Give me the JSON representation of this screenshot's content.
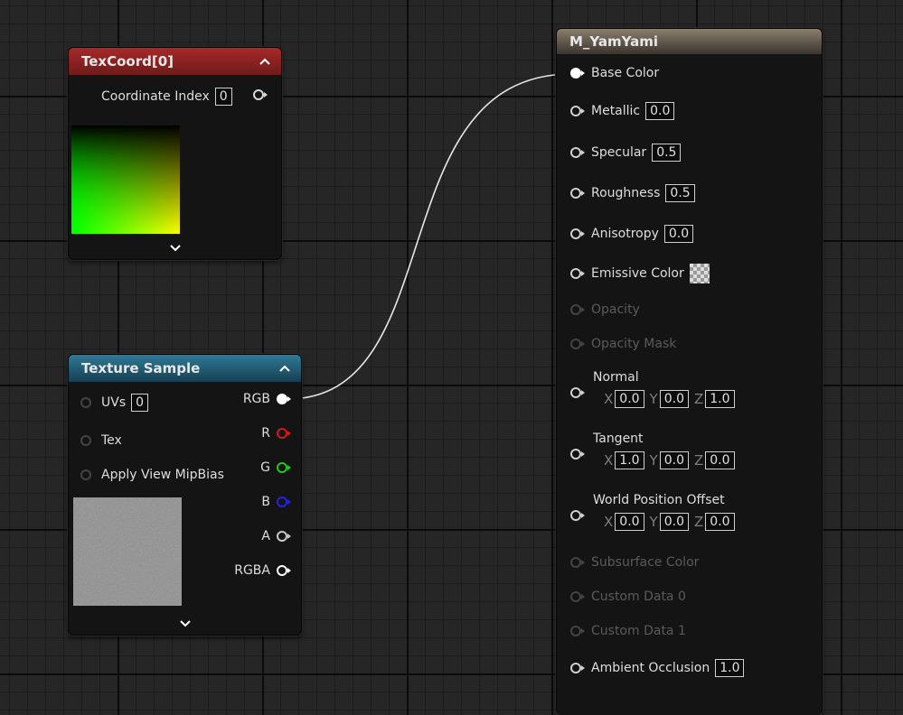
{
  "texcoord": {
    "title": "TexCoord[0]",
    "coordinate_index_label": "Coordinate Index",
    "coordinate_index_value": "0",
    "header_color": "#8a1f1f"
  },
  "texture_sample": {
    "title": "Texture Sample",
    "header_color": "#1f5a73",
    "inputs": [
      {
        "label": "UVs",
        "value": "0"
      },
      {
        "label": "Tex"
      },
      {
        "label": "Apply View MipBias"
      }
    ],
    "outputs": [
      {
        "label": "RGB",
        "color": "#ffffff"
      },
      {
        "label": "R",
        "color": "#d21a1a"
      },
      {
        "label": "G",
        "color": "#1ec81e"
      },
      {
        "label": "B",
        "color": "#2323e0"
      },
      {
        "label": "A",
        "color": "#c8c8c8"
      },
      {
        "label": "RGBA",
        "color": "#ffffff"
      }
    ]
  },
  "material": {
    "title": "M_YamYami",
    "header_color": "#5a5146",
    "base_color": "Base Color",
    "metallic": {
      "label": "Metallic",
      "value": "0.0"
    },
    "specular": {
      "label": "Specular",
      "value": "0.5"
    },
    "roughness": {
      "label": "Roughness",
      "value": "0.5"
    },
    "anisotropy": {
      "label": "Anisotropy",
      "value": "0.0"
    },
    "emissive": "Emissive Color",
    "opacity": "Opacity",
    "opacity_mask": "Opacity Mask",
    "normal": {
      "label": "Normal",
      "x": "0.0",
      "y": "0.0",
      "z": "1.0"
    },
    "tangent": {
      "label": "Tangent",
      "x": "1.0",
      "y": "0.0",
      "z": "0.0"
    },
    "wpo": {
      "label": "World Position Offset",
      "x": "0.0",
      "y": "0.0",
      "z": "0.0"
    },
    "subsurface": "Subsurface Color",
    "custom0": "Custom Data 0",
    "custom1": "Custom Data 1",
    "ao": {
      "label": "Ambient Occlusion",
      "value": "1.0"
    },
    "axis_x": "X",
    "axis_y": "Y",
    "axis_z": "Z"
  }
}
